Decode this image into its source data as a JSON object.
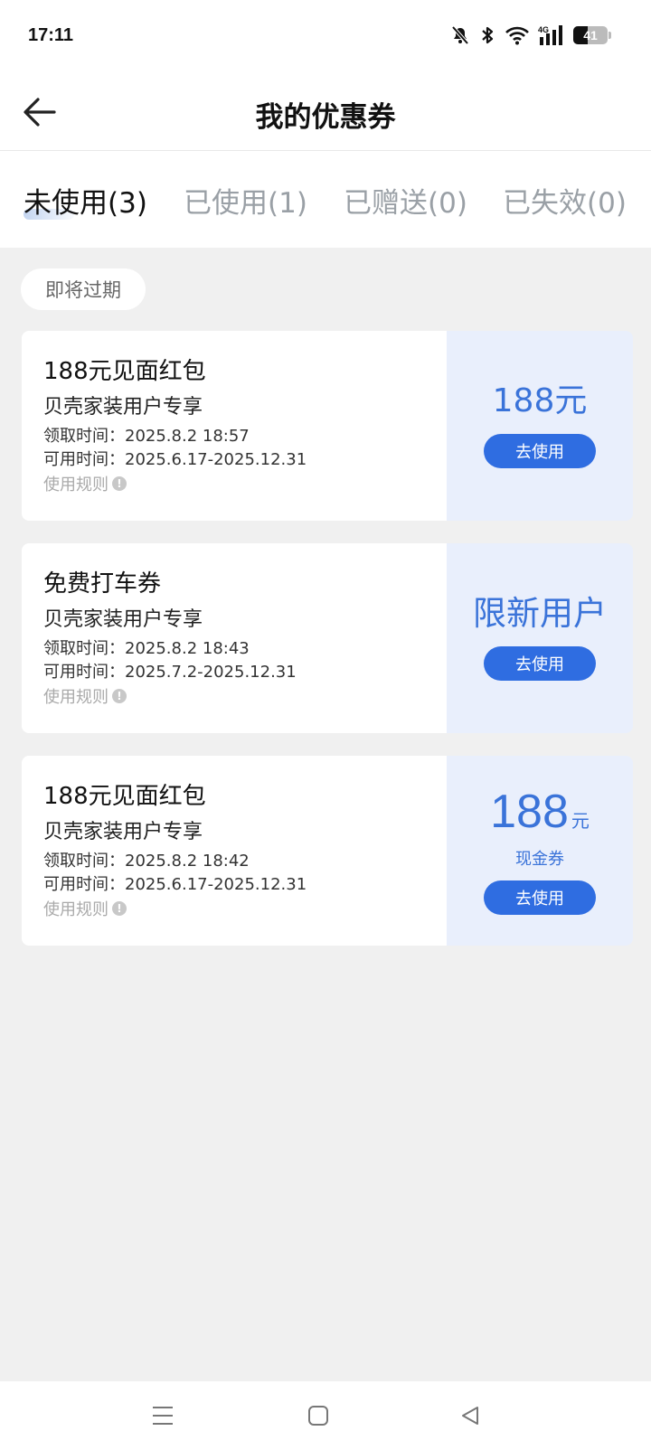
{
  "status_bar": {
    "time": "17:11",
    "network_label": "4G",
    "battery_level": "41",
    "icons": [
      "mute-bell-icon",
      "bluetooth-icon",
      "wifi-icon",
      "signal-4g-icon",
      "battery-icon"
    ]
  },
  "header": {
    "back_icon": "arrow-left-icon",
    "title": "我的优惠券"
  },
  "tabs": [
    {
      "label": "未使用(3)",
      "active": true
    },
    {
      "label": "已使用(1)",
      "active": false
    },
    {
      "label": "已赠送(0)",
      "active": false
    },
    {
      "label": "已失效(0)",
      "active": false
    }
  ],
  "filter_chip": "即将过期",
  "coupons": [
    {
      "title": "188元见面红包",
      "subtitle": "贝壳家装用户专享",
      "received_label": "领取时间：",
      "received_time": "2025.8.2 18:57",
      "valid_label": "可用时间：",
      "valid_time": "2025.6.17-2025.12.31",
      "rules": "使用规则",
      "value_text": "188元",
      "button": "去使用"
    },
    {
      "title": "免费打车券",
      "subtitle": "贝壳家装用户专享",
      "received_label": "领取时间：",
      "received_time": "2025.8.2 18:43",
      "valid_label": "可用时间：",
      "valid_time": "2025.7.2-2025.12.31",
      "rules": "使用规则",
      "value_text": "限新用户",
      "button": "去使用"
    },
    {
      "title": "188元见面红包",
      "subtitle": "贝壳家装用户专享",
      "received_label": "领取时间：",
      "received_time": "2025.8.2 18:42",
      "valid_label": "可用时间：",
      "valid_time": "2025.6.17-2025.12.31",
      "rules": "使用规则",
      "value_number": "188",
      "value_unit": "元",
      "value_caption": "现金券",
      "button": "去使用"
    }
  ],
  "nav_bar": {
    "icons": [
      "menu-icon",
      "home-square-icon",
      "back-triangle-icon"
    ]
  },
  "colors": {
    "accent": "#2f6de1",
    "accent_text": "#3a73d9",
    "coupon_right_bg": "#e9effc",
    "page_bg": "#f0f0f0"
  }
}
